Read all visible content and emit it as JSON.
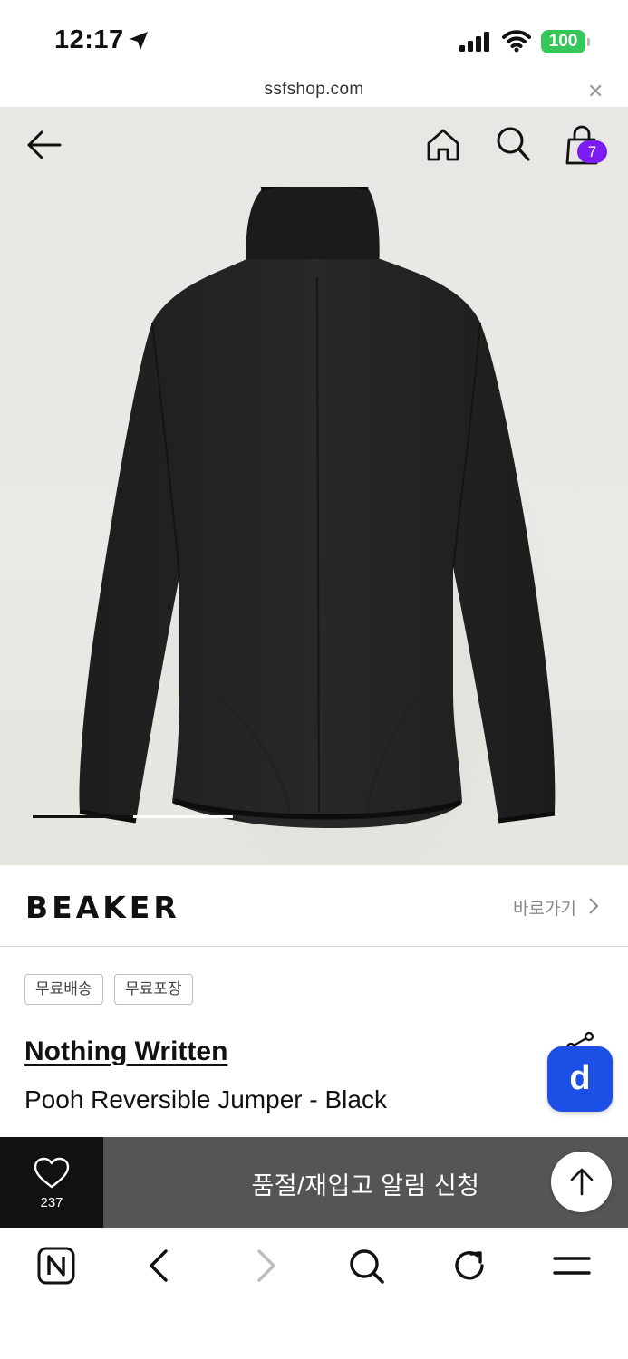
{
  "status_bar": {
    "time": "12:17",
    "battery": "100",
    "battery_color": "#34c759"
  },
  "url_bar": {
    "url": "ssfshop.com",
    "close_icon": "close-icon"
  },
  "header_nav": {
    "icons": [
      "back-arrow-icon",
      "home-icon",
      "search-icon",
      "shopping-bag-icon"
    ],
    "cart_count": "7",
    "cart_badge_color": "#7b1cf2"
  },
  "gallery": {
    "image": "black jacket back view",
    "current_slide_fraction": 0.5
  },
  "brand_row": {
    "logo_text": "BEAKER",
    "link_label": "바로가기"
  },
  "product": {
    "tags": [
      "무료배송",
      "무료포장"
    ],
    "brand": "Nothing Written",
    "name": "Pooh Reversible Jumper - Black"
  },
  "floating_button": {
    "label": "d",
    "color": "#1b4fe6"
  },
  "action_bar": {
    "like_count": "237",
    "notify_label": "품절/재입고 알림 신청"
  },
  "browser_toolbar": {
    "icons": [
      "naver-n-icon",
      "back-icon",
      "forward-icon",
      "search-icon",
      "reload-icon",
      "menu-icon"
    ]
  }
}
